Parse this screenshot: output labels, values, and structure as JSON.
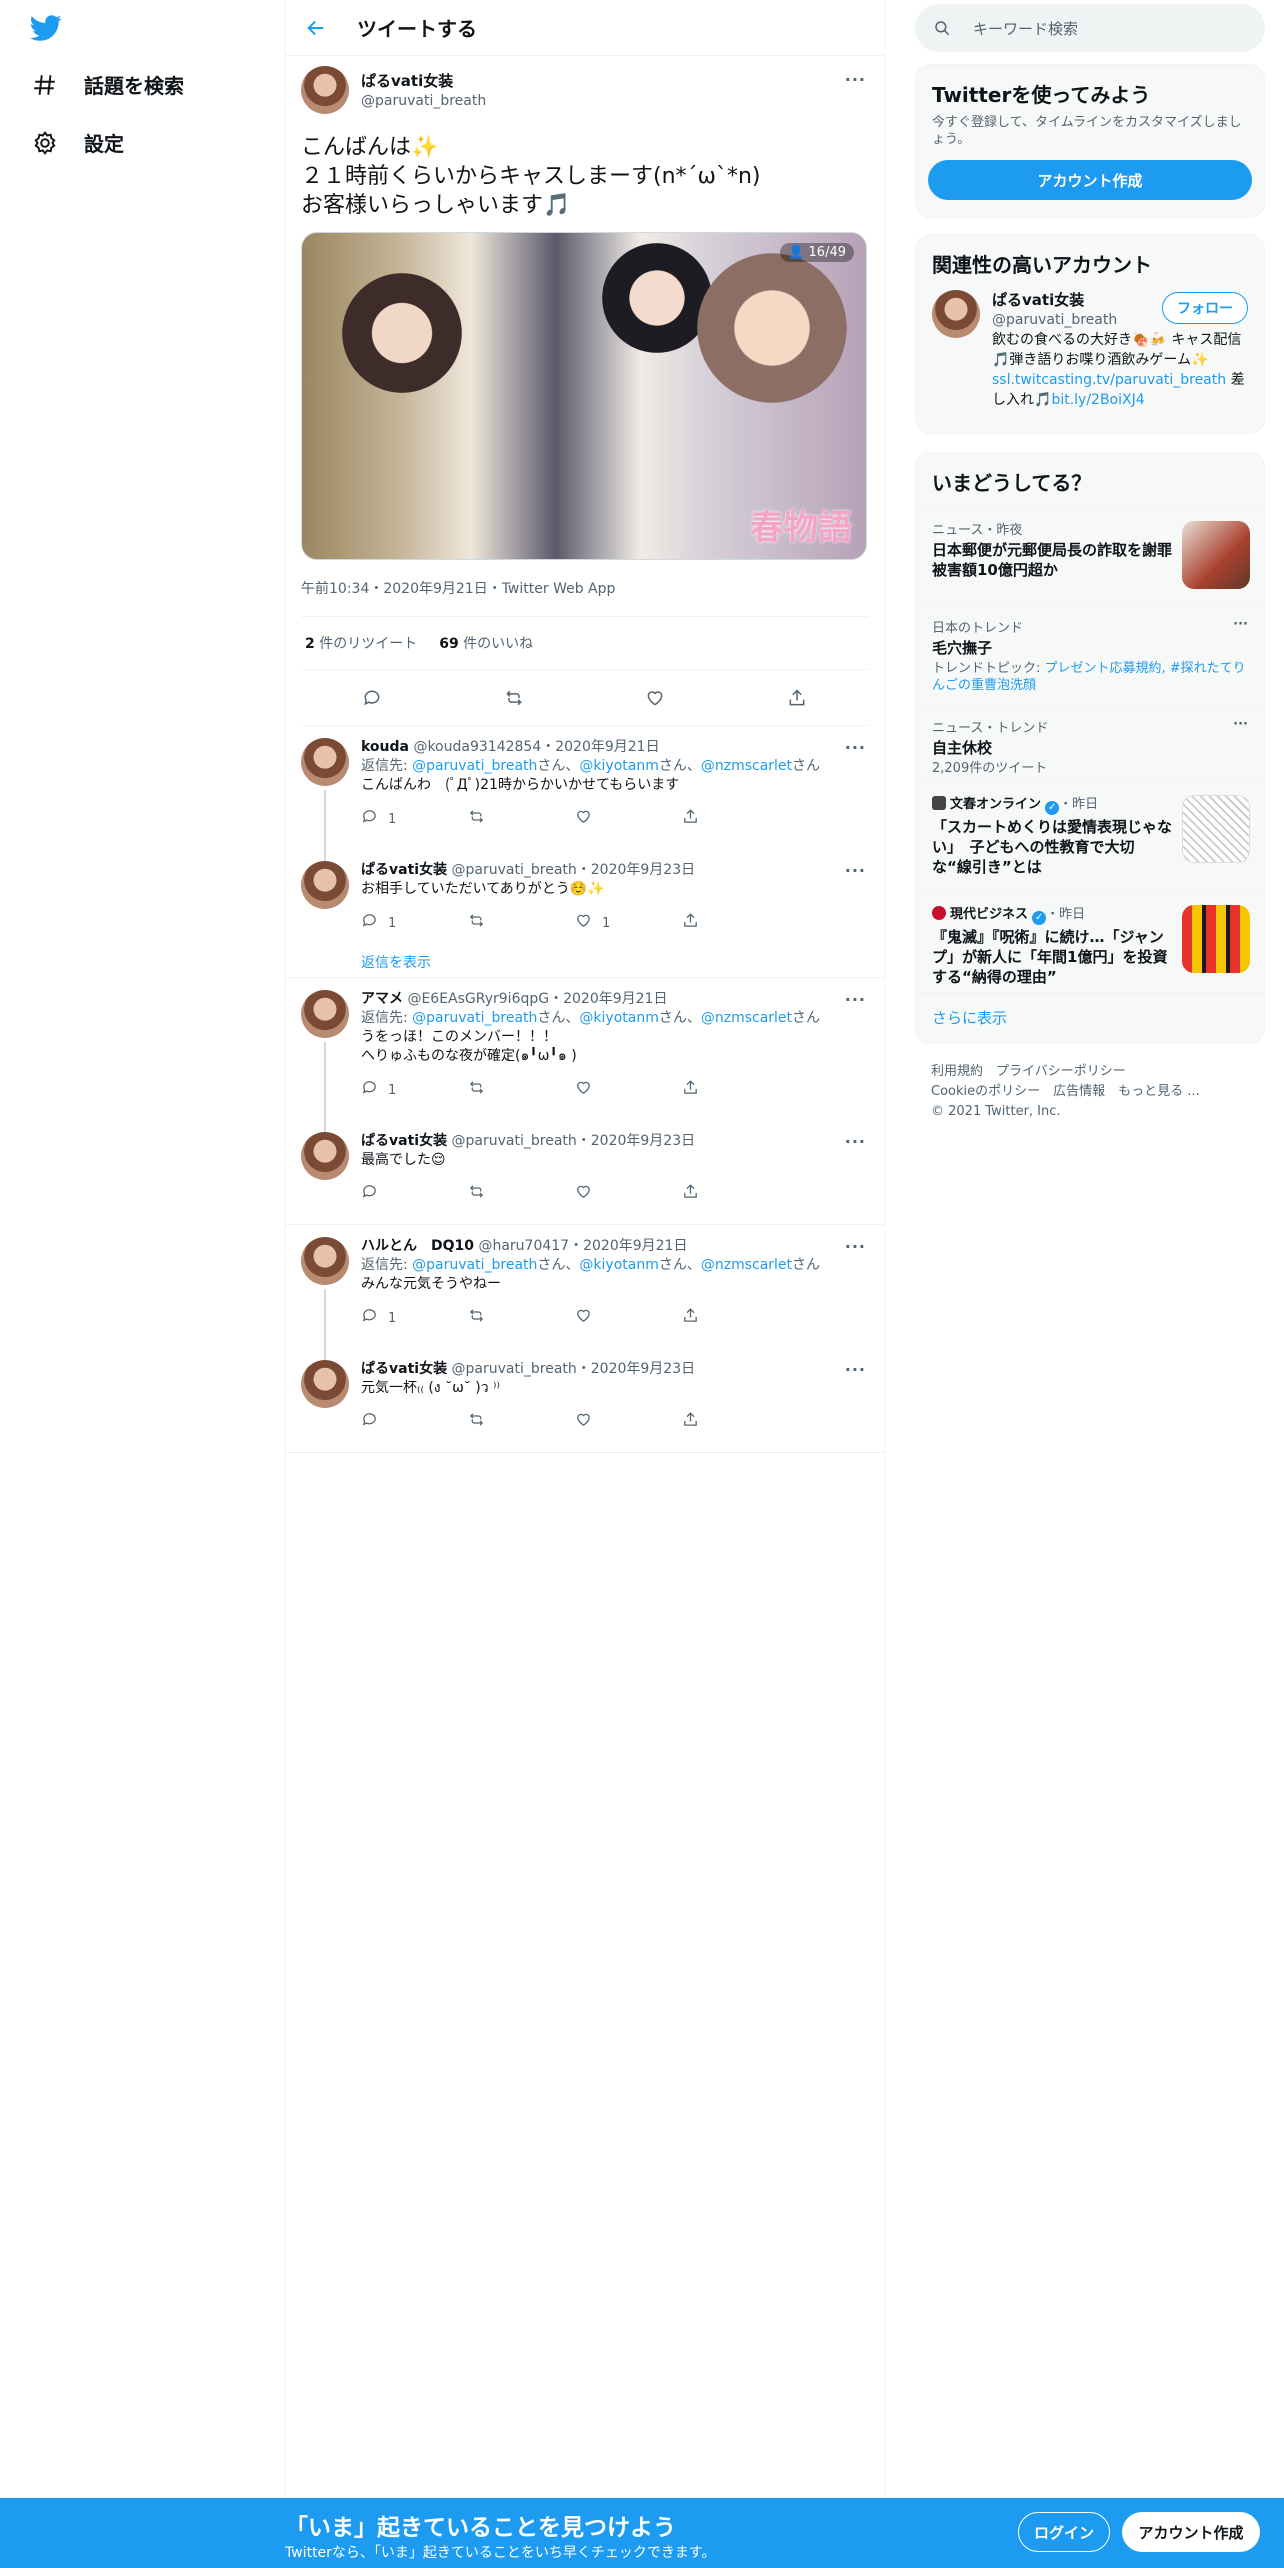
{
  "nav": {
    "explore": "話題を検索",
    "settings": "設定"
  },
  "header": {
    "title": "ツイートする"
  },
  "tweet": {
    "display_name": "ぱるvati女装",
    "handle": "@paruvati_breath",
    "body": "こんばんは✨\n２１時前くらいからキャスしまーす(n*´ω`*n)\nお客様いらっしゃいます🎵",
    "media_counter": "👤 16/49",
    "media_stamp": "春物語",
    "meta": "午前10:34・2020年9月21日・Twitter Web App",
    "retweets_count": "2",
    "retweets_label": "件のリツイート",
    "likes_count": "69",
    "likes_label": "件のいいね"
  },
  "replies": [
    {
      "name": "kouda",
      "handle": "@kouda93142854",
      "date": "・2020年9月21日",
      "reply_to": true,
      "text": "こんばんわ　(ﾟДﾟ)21時からかいかせてもらいます",
      "reply_count": "1",
      "retweet_count": "",
      "like_count": "",
      "thread_continues": true
    },
    {
      "name": "ぱるvati女装",
      "handle": "@paruvati_breath",
      "date": "・2020年9月23日",
      "reply_to": false,
      "text": "お相手していただいてありがとう☺️✨",
      "reply_count": "1",
      "retweet_count": "",
      "like_count": "1",
      "thread_continues": false
    },
    {
      "name": "アマメ",
      "handle": "@E6EAsGRyr9i6qpG",
      "date": "・2020年9月21日",
      "reply_to": true,
      "text": "うをっほ！このメンバー！！！\nへりゅふものな夜が確定(๑╹ω╹๑ )",
      "reply_count": "1",
      "retweet_count": "",
      "like_count": "",
      "thread_continues": true
    },
    {
      "name": "ぱるvati女装",
      "handle": "@paruvati_breath",
      "date": "・2020年9月23日",
      "reply_to": false,
      "text": "最高でした😌",
      "reply_count": "",
      "retweet_count": "",
      "like_count": "",
      "thread_continues": false
    },
    {
      "name": "ハルとん　DQ10",
      "handle": "@haru70417",
      "date": "・2020年9月21日",
      "reply_to": true,
      "text": "みんな元気そうやねー",
      "reply_count": "1",
      "retweet_count": "",
      "like_count": "",
      "thread_continues": true
    },
    {
      "name": "ぱるvati女装",
      "handle": "@paruvati_breath",
      "date": "・2020年9月23日",
      "reply_to": false,
      "text": "元気一杯₍₍ (ง ˘ω˘ )ว ⁾⁾",
      "reply_count": "",
      "retweet_count": "",
      "like_count": "",
      "thread_continues": false
    }
  ],
  "reply_to": {
    "prefix": "返信先: ",
    "user1": "@paruvati_breath",
    "user2": "@kiyotanm",
    "user3": "@nzmscarlet",
    "san": "さん",
    "sep": "、"
  },
  "show_replies": "返信を表示",
  "search": {
    "placeholder": "キーワード検索"
  },
  "signup_card": {
    "title": "Twitterを使ってみよう",
    "subtitle": "今すぐ登録して、タイムラインをカスタマイズしましょう。",
    "button": "アカウント作成"
  },
  "related": {
    "title": "関連性の高いアカウント",
    "name": "ぱるvati女装",
    "handle": "@paruvati_breath",
    "follow": "フォロー",
    "bio_a": "飲むの食べるの大好き🍖🍻 キャス配信🎵弾き語りお喋り酒飲みゲーム✨",
    "bio_link1": "ssl.twitcasting.tv/paruvati_breath",
    "bio_b": "差し入れ🎵",
    "bio_link2": "bit.ly/2BoiXJ4"
  },
  "trends": {
    "title": "いまどうしてる？",
    "items": [
      {
        "category": "ニュース・昨夜",
        "title": "日本郵便が元郵便局長の詐取を謝罪 被害額10億円超か",
        "sub": ""
      },
      {
        "category": "日本のトレンド",
        "title": "毛穴撫子",
        "sub_prefix": "トレンドトピック: ",
        "sub_link": "プレゼント応募規約, #探れたてりんごの重曹泡洗顔"
      },
      {
        "category": "ニュース・トレンド",
        "title": "自主休校",
        "sub": "2,209件のツイート"
      },
      {
        "source": "文春オンライン",
        "time": "・昨日",
        "title": "「スカートめくりは愛情表現じゃない」　子どもへの性教育で大切な“線引き”とは"
      },
      {
        "source": "現代ビジネス",
        "time": "・昨日",
        "title": "『鬼滅』『呪術』に続け…「ジャンプ」が新人に「年間1億円」を投資する“納得の理由”"
      }
    ],
    "more": "さらに表示"
  },
  "footer": {
    "terms": "利用規約",
    "privacy": "プライバシーポリシー",
    "cookie": "Cookieのポリシー",
    "ads": "広告情報",
    "more": "もっと見る ...",
    "copyright": "© 2021 Twitter, Inc."
  },
  "bottom_bar": {
    "title": "「いま」起きていることを見つけよう",
    "subtitle": "Twitterなら、「いま」起きていることをいち早くチェックできます。",
    "login": "ログイン",
    "signup": "アカウント作成"
  },
  "colors": {
    "accent": "#1d9bf0",
    "text": "#0f1419",
    "muted": "#536471"
  }
}
